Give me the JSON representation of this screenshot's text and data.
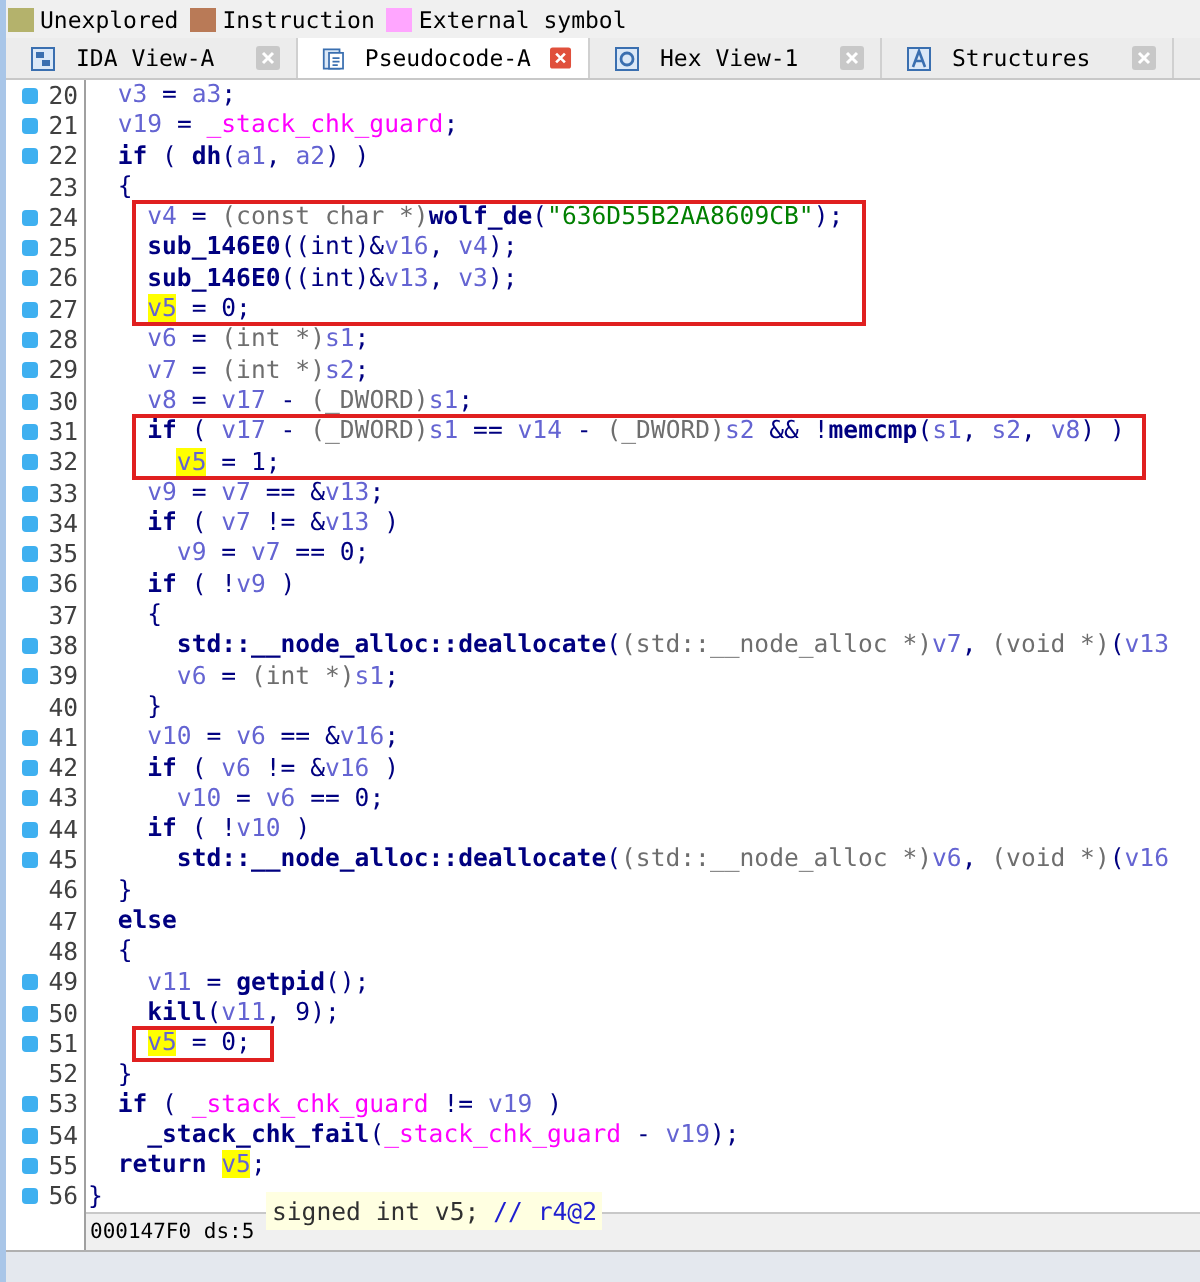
{
  "legend": [
    {
      "label": "Unexplored",
      "color": "#b4b26c"
    },
    {
      "label": "Instruction",
      "color": "#b97a57"
    },
    {
      "label": "External symbol",
      "color": "#ffa6ff"
    }
  ],
  "tabs": [
    {
      "label": "IDA View-A",
      "kind": "graph",
      "selected": false
    },
    {
      "label": "Pseudocode-A",
      "kind": "pseudocode",
      "selected": true
    },
    {
      "label": "Hex View-1",
      "kind": "hex",
      "selected": false
    },
    {
      "label": "Structures",
      "kind": "struct",
      "selected": false
    }
  ],
  "lines": [
    {
      "number": "20",
      "marker": true,
      "boxed": false,
      "tokens": [
        {
          "kind": "v",
          "text": "  v3"
        },
        {
          "kind": "p",
          "text": " = "
        },
        {
          "kind": "v",
          "text": "a3"
        },
        {
          "kind": "p",
          "text": ";"
        }
      ]
    },
    {
      "number": "21",
      "marker": true,
      "boxed": false,
      "tokens": [
        {
          "kind": "v",
          "text": "  v19"
        },
        {
          "kind": "p",
          "text": " = "
        },
        {
          "kind": "g",
          "text": "_stack_chk_guard"
        },
        {
          "kind": "p",
          "text": ";"
        }
      ]
    },
    {
      "number": "22",
      "marker": true,
      "boxed": false,
      "tokens": [
        {
          "kind": "f",
          "text": "  if"
        },
        {
          "kind": "p",
          "text": " ( "
        },
        {
          "kind": "f",
          "text": "dh"
        },
        {
          "kind": "p",
          "text": "("
        },
        {
          "kind": "v",
          "text": "a1"
        },
        {
          "kind": "p",
          "text": ", "
        },
        {
          "kind": "v",
          "text": "a2"
        },
        {
          "kind": "p",
          "text": ") )"
        }
      ]
    },
    {
      "number": "23",
      "marker": false,
      "boxed": false,
      "tokens": [
        {
          "kind": "p",
          "text": "  {"
        }
      ]
    },
    {
      "number": "24",
      "marker": true,
      "boxed": true,
      "tokens": [
        {
          "kind": "v",
          "text": "    v4"
        },
        {
          "kind": "p",
          "text": " = "
        },
        {
          "kind": "c",
          "text": "(const char *)"
        },
        {
          "kind": "f",
          "text": "wolf_de"
        },
        {
          "kind": "p",
          "text": "("
        },
        {
          "kind": "s",
          "text": "\"636D55B2AA8609CB\""
        },
        {
          "kind": "p",
          "text": ");"
        }
      ]
    },
    {
      "number": "25",
      "marker": true,
      "boxed": true,
      "tokens": [
        {
          "kind": "f",
          "text": "    sub_146E0"
        },
        {
          "kind": "p",
          "text": "((int)&"
        },
        {
          "kind": "v",
          "text": "v16"
        },
        {
          "kind": "p",
          "text": ", "
        },
        {
          "kind": "v",
          "text": "v4"
        },
        {
          "kind": "p",
          "text": ");"
        }
      ]
    },
    {
      "number": "26",
      "marker": true,
      "boxed": true,
      "tokens": [
        {
          "kind": "f",
          "text": "    sub_146E0"
        },
        {
          "kind": "p",
          "text": "((int)&"
        },
        {
          "kind": "v",
          "text": "v13"
        },
        {
          "kind": "p",
          "text": ", "
        },
        {
          "kind": "v",
          "text": "v3"
        },
        {
          "kind": "p",
          "text": ");"
        }
      ]
    },
    {
      "number": "27",
      "marker": true,
      "boxed": true,
      "tokens": [
        {
          "kind": "h",
          "text": "    v5"
        },
        {
          "kind": "p",
          "text": " = 0;"
        }
      ]
    },
    {
      "number": "28",
      "marker": true,
      "boxed": false,
      "tokens": [
        {
          "kind": "v",
          "text": "    v6"
        },
        {
          "kind": "p",
          "text": " = "
        },
        {
          "kind": "c",
          "text": "(int *)"
        },
        {
          "kind": "v",
          "text": "s1"
        },
        {
          "kind": "p",
          "text": ";"
        }
      ]
    },
    {
      "number": "29",
      "marker": true,
      "boxed": false,
      "tokens": [
        {
          "kind": "v",
          "text": "    v7"
        },
        {
          "kind": "p",
          "text": " = "
        },
        {
          "kind": "c",
          "text": "(int *)"
        },
        {
          "kind": "v",
          "text": "s2"
        },
        {
          "kind": "p",
          "text": ";"
        }
      ]
    },
    {
      "number": "30",
      "marker": true,
      "boxed": false,
      "tokens": [
        {
          "kind": "v",
          "text": "    v8"
        },
        {
          "kind": "p",
          "text": " = "
        },
        {
          "kind": "v",
          "text": "v17"
        },
        {
          "kind": "p",
          "text": " - "
        },
        {
          "kind": "c",
          "text": "(_DWORD)"
        },
        {
          "kind": "v",
          "text": "s1"
        },
        {
          "kind": "p",
          "text": ";"
        }
      ]
    },
    {
      "number": "31",
      "marker": true,
      "boxed": true,
      "tokens": [
        {
          "kind": "f",
          "text": "    if"
        },
        {
          "kind": "p",
          "text": " ( "
        },
        {
          "kind": "v",
          "text": "v17"
        },
        {
          "kind": "p",
          "text": " - "
        },
        {
          "kind": "c",
          "text": "(_DWORD)"
        },
        {
          "kind": "v",
          "text": "s1"
        },
        {
          "kind": "p",
          "text": " == "
        },
        {
          "kind": "v",
          "text": "v14"
        },
        {
          "kind": "p",
          "text": " - "
        },
        {
          "kind": "c",
          "text": "(_DWORD)"
        },
        {
          "kind": "v",
          "text": "s2"
        },
        {
          "kind": "p",
          "text": " && !"
        },
        {
          "kind": "f",
          "text": "memcmp"
        },
        {
          "kind": "p",
          "text": "("
        },
        {
          "kind": "v",
          "text": "s1"
        },
        {
          "kind": "p",
          "text": ", "
        },
        {
          "kind": "v",
          "text": "s2"
        },
        {
          "kind": "p",
          "text": ", "
        },
        {
          "kind": "v",
          "text": "v8"
        },
        {
          "kind": "p",
          "text": ") )"
        }
      ]
    },
    {
      "number": "32",
      "marker": true,
      "boxed": true,
      "tokens": [
        {
          "kind": "h",
          "text": "      v5"
        },
        {
          "kind": "p",
          "text": " = 1;"
        }
      ]
    },
    {
      "number": "33",
      "marker": true,
      "boxed": false,
      "tokens": [
        {
          "kind": "v",
          "text": "    v9"
        },
        {
          "kind": "p",
          "text": " = "
        },
        {
          "kind": "v",
          "text": "v7"
        },
        {
          "kind": "p",
          "text": " == &"
        },
        {
          "kind": "v",
          "text": "v13"
        },
        {
          "kind": "p",
          "text": ";"
        }
      ]
    },
    {
      "number": "34",
      "marker": true,
      "boxed": false,
      "tokens": [
        {
          "kind": "f",
          "text": "    if"
        },
        {
          "kind": "p",
          "text": " ( "
        },
        {
          "kind": "v",
          "text": "v7"
        },
        {
          "kind": "p",
          "text": " != &"
        },
        {
          "kind": "v",
          "text": "v13"
        },
        {
          "kind": "p",
          "text": " )"
        }
      ]
    },
    {
      "number": "35",
      "marker": true,
      "boxed": false,
      "tokens": [
        {
          "kind": "v",
          "text": "      v9"
        },
        {
          "kind": "p",
          "text": " = "
        },
        {
          "kind": "v",
          "text": "v7"
        },
        {
          "kind": "p",
          "text": " == 0;"
        }
      ]
    },
    {
      "number": "36",
      "marker": true,
      "boxed": false,
      "tokens": [
        {
          "kind": "f",
          "text": "    if"
        },
        {
          "kind": "p",
          "text": " ( !"
        },
        {
          "kind": "v",
          "text": "v9"
        },
        {
          "kind": "p",
          "text": " )"
        }
      ]
    },
    {
      "number": "37",
      "marker": false,
      "boxed": false,
      "tokens": [
        {
          "kind": "p",
          "text": "    {"
        }
      ]
    },
    {
      "number": "38",
      "marker": true,
      "boxed": false,
      "tokens": [
        {
          "kind": "f",
          "text": "      std::__node_alloc::deallocate"
        },
        {
          "kind": "p",
          "text": "("
        },
        {
          "kind": "c",
          "text": "(std::__node_alloc *)"
        },
        {
          "kind": "v",
          "text": "v7"
        },
        {
          "kind": "p",
          "text": ", "
        },
        {
          "kind": "c",
          "text": "(void *)"
        },
        {
          "kind": "p",
          "text": "("
        },
        {
          "kind": "v",
          "text": "v13"
        }
      ]
    },
    {
      "number": "39",
      "marker": true,
      "boxed": false,
      "tokens": [
        {
          "kind": "v",
          "text": "      v6"
        },
        {
          "kind": "p",
          "text": " = "
        },
        {
          "kind": "c",
          "text": "(int *)"
        },
        {
          "kind": "v",
          "text": "s1"
        },
        {
          "kind": "p",
          "text": ";"
        }
      ]
    },
    {
      "number": "40",
      "marker": false,
      "boxed": false,
      "tokens": [
        {
          "kind": "p",
          "text": "    }"
        }
      ]
    },
    {
      "number": "41",
      "marker": true,
      "boxed": false,
      "tokens": [
        {
          "kind": "v",
          "text": "    v10"
        },
        {
          "kind": "p",
          "text": " = "
        },
        {
          "kind": "v",
          "text": "v6"
        },
        {
          "kind": "p",
          "text": " == &"
        },
        {
          "kind": "v",
          "text": "v16"
        },
        {
          "kind": "p",
          "text": ";"
        }
      ]
    },
    {
      "number": "42",
      "marker": true,
      "boxed": false,
      "tokens": [
        {
          "kind": "f",
          "text": "    if"
        },
        {
          "kind": "p",
          "text": " ( "
        },
        {
          "kind": "v",
          "text": "v6"
        },
        {
          "kind": "p",
          "text": " != &"
        },
        {
          "kind": "v",
          "text": "v16"
        },
        {
          "kind": "p",
          "text": " )"
        }
      ]
    },
    {
      "number": "43",
      "marker": true,
      "boxed": false,
      "tokens": [
        {
          "kind": "v",
          "text": "      v10"
        },
        {
          "kind": "p",
          "text": " = "
        },
        {
          "kind": "v",
          "text": "v6"
        },
        {
          "kind": "p",
          "text": " == 0;"
        }
      ]
    },
    {
      "number": "44",
      "marker": true,
      "boxed": false,
      "tokens": [
        {
          "kind": "f",
          "text": "    if"
        },
        {
          "kind": "p",
          "text": " ( !"
        },
        {
          "kind": "v",
          "text": "v10"
        },
        {
          "kind": "p",
          "text": " )"
        }
      ]
    },
    {
      "number": "45",
      "marker": true,
      "boxed": false,
      "tokens": [
        {
          "kind": "f",
          "text": "      std::__node_alloc::deallocate"
        },
        {
          "kind": "p",
          "text": "("
        },
        {
          "kind": "c",
          "text": "(std::__node_alloc *)"
        },
        {
          "kind": "v",
          "text": "v6"
        },
        {
          "kind": "p",
          "text": ", "
        },
        {
          "kind": "c",
          "text": "(void *)"
        },
        {
          "kind": "p",
          "text": "("
        },
        {
          "kind": "v",
          "text": "v16"
        }
      ]
    },
    {
      "number": "46",
      "marker": false,
      "boxed": false,
      "tokens": [
        {
          "kind": "p",
          "text": "  }"
        }
      ]
    },
    {
      "number": "47",
      "marker": false,
      "boxed": false,
      "tokens": [
        {
          "kind": "f",
          "text": "  else"
        }
      ]
    },
    {
      "number": "48",
      "marker": false,
      "boxed": false,
      "tokens": [
        {
          "kind": "p",
          "text": "  {"
        }
      ]
    },
    {
      "number": "49",
      "marker": true,
      "boxed": false,
      "tokens": [
        {
          "kind": "v",
          "text": "    v11"
        },
        {
          "kind": "p",
          "text": " = "
        },
        {
          "kind": "f",
          "text": "getpid"
        },
        {
          "kind": "p",
          "text": "();"
        }
      ]
    },
    {
      "number": "50",
      "marker": true,
      "boxed": false,
      "tokens": [
        {
          "kind": "f",
          "text": "    kill"
        },
        {
          "kind": "p",
          "text": "("
        },
        {
          "kind": "v",
          "text": "v11"
        },
        {
          "kind": "p",
          "text": ", 9);"
        }
      ]
    },
    {
      "number": "51",
      "marker": true,
      "boxed": true,
      "tokens": [
        {
          "kind": "h",
          "text": "    v5"
        },
        {
          "kind": "p",
          "text": " = 0;"
        }
      ]
    },
    {
      "number": "52",
      "marker": false,
      "boxed": false,
      "tokens": [
        {
          "kind": "p",
          "text": "  }"
        }
      ]
    },
    {
      "number": "53",
      "marker": true,
      "boxed": false,
      "tokens": [
        {
          "kind": "f",
          "text": "  if"
        },
        {
          "kind": "p",
          "text": " ( "
        },
        {
          "kind": "g",
          "text": "_stack_chk_guard"
        },
        {
          "kind": "p",
          "text": " != "
        },
        {
          "kind": "v",
          "text": "v19"
        },
        {
          "kind": "p",
          "text": " )"
        }
      ]
    },
    {
      "number": "54",
      "marker": true,
      "boxed": false,
      "tokens": [
        {
          "kind": "f",
          "text": "    _stack_chk_fail"
        },
        {
          "kind": "p",
          "text": "("
        },
        {
          "kind": "g",
          "text": "_stack_chk_guard"
        },
        {
          "kind": "p",
          "text": " - "
        },
        {
          "kind": "v",
          "text": "v19"
        },
        {
          "kind": "p",
          "text": ");"
        }
      ]
    },
    {
      "number": "55",
      "marker": true,
      "boxed": false,
      "tokens": [
        {
          "kind": "f",
          "text": "  return"
        },
        {
          "kind": "h",
          "text": " v5"
        },
        {
          "kind": "p",
          "text": ";"
        }
      ]
    },
    {
      "number": "56",
      "marker": true,
      "boxed": false,
      "tokens": [
        {
          "kind": "p",
          "text": "}"
        }
      ]
    }
  ],
  "tooltip": {
    "declaration": "signed int v5;",
    "comment": "// r4@2"
  },
  "status_bar": {
    "address": "000147F0 ds:5"
  }
}
